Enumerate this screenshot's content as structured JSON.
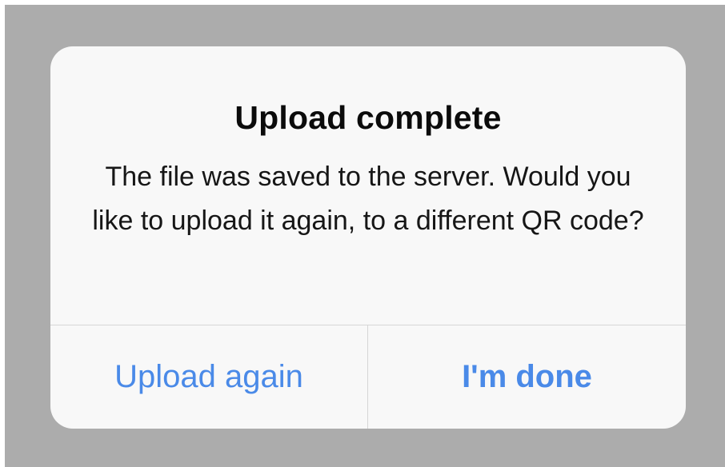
{
  "alert": {
    "title": "Upload complete",
    "message": "The file was saved to the server. Would you like to upload it again, to a different QR code?",
    "buttons": {
      "secondary_label": "Upload again",
      "primary_label": "I'm done"
    }
  },
  "colors": {
    "overlay": "#acacac",
    "alert_background": "#f8f8f8",
    "button_text": "#4a8ae8",
    "divider": "#d6d6d6"
  }
}
